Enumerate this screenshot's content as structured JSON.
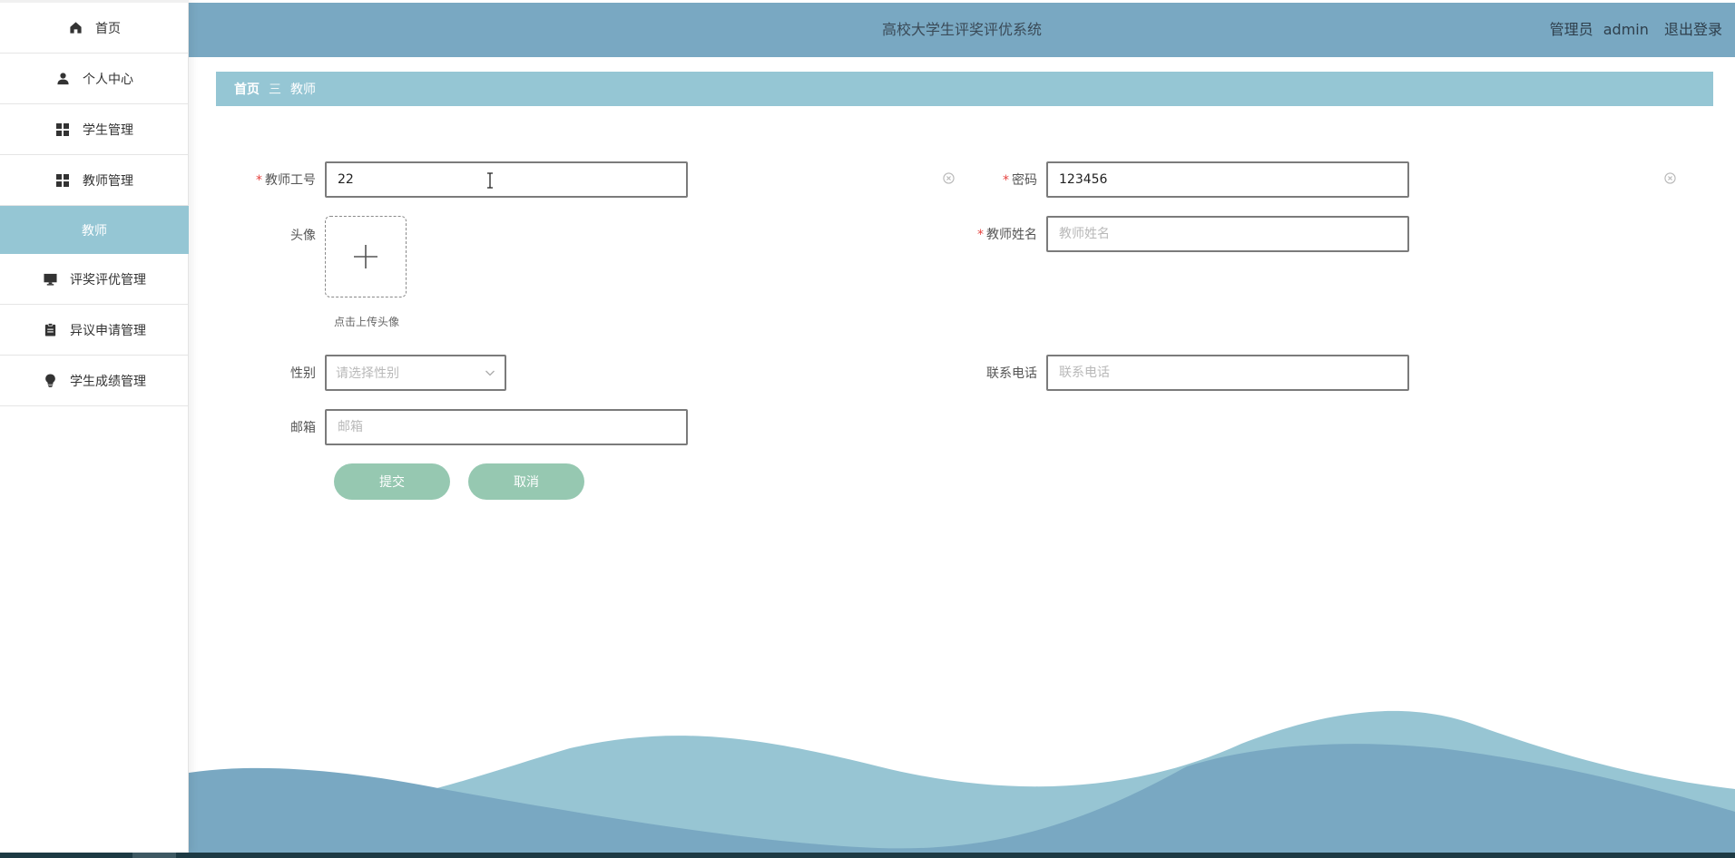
{
  "app": {
    "title": "高校大学生评奖评优系统",
    "user_role": "管理员",
    "username": "admin",
    "logout_label": "退出登录"
  },
  "sidebar": {
    "items": [
      {
        "label": "首页",
        "icon": "home-icon"
      },
      {
        "label": "个人中心",
        "icon": "user-icon"
      },
      {
        "label": "学生管理",
        "icon": "grid-icon"
      },
      {
        "label": "教师管理",
        "icon": "grid-icon"
      },
      {
        "label": "教师",
        "icon": "",
        "active": true
      },
      {
        "label": "评奖评优管理",
        "icon": "monitor-icon"
      },
      {
        "label": "异议申请管理",
        "icon": "clipboard-icon"
      },
      {
        "label": "学生成绩管理",
        "icon": "bulb-icon"
      }
    ]
  },
  "breadcrumb": {
    "home": "首页",
    "separator": "三",
    "current": "教师"
  },
  "form": {
    "teacher_id": {
      "label": "教师工号",
      "value": "22",
      "required": true
    },
    "password": {
      "label": "密码",
      "value": "123456",
      "required": true
    },
    "avatar": {
      "label": "头像",
      "upload_tip": "点击上传头像"
    },
    "teacher_name": {
      "label": "教师姓名",
      "placeholder": "教师姓名",
      "required": true
    },
    "gender": {
      "label": "性别",
      "placeholder": "请选择性别"
    },
    "phone": {
      "label": "联系电话",
      "placeholder": "联系电话"
    },
    "email": {
      "label": "邮箱",
      "placeholder": "邮箱"
    },
    "required_mark": "*",
    "submit_label": "提交",
    "cancel_label": "取消"
  },
  "colors": {
    "header_bg": "#79a8c2",
    "accent_light": "#95c6d4",
    "button_bg": "#96c8b1",
    "required": "#e64340"
  }
}
